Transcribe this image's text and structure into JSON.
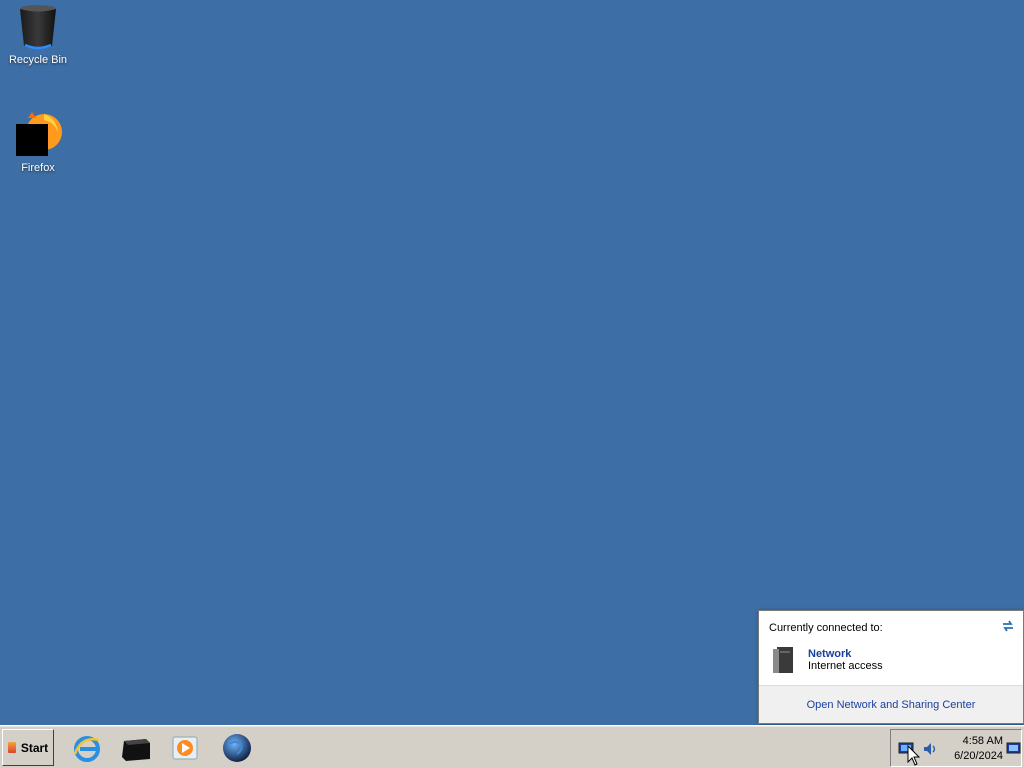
{
  "desktop": {
    "icons": [
      {
        "label": "Recycle Bin",
        "icon": "recycle-bin-icon"
      },
      {
        "label": "Firefox",
        "icon": "firefox-icon"
      }
    ],
    "background_color": "#3d6ea5"
  },
  "network_popup": {
    "connected_label": "Currently connected to:",
    "network_name": "Network",
    "network_status": "Internet access",
    "footer_link": "Open Network and Sharing Center"
  },
  "taskbar": {
    "start_label": "Start",
    "pinned_apps": [
      {
        "icon": "internet-explorer-icon"
      },
      {
        "icon": "file-explorer-icon"
      },
      {
        "icon": "media-player-icon"
      },
      {
        "icon": "globe-icon"
      }
    ],
    "tray": {
      "time": "4:58 AM",
      "date": "6/20/2024"
    }
  }
}
